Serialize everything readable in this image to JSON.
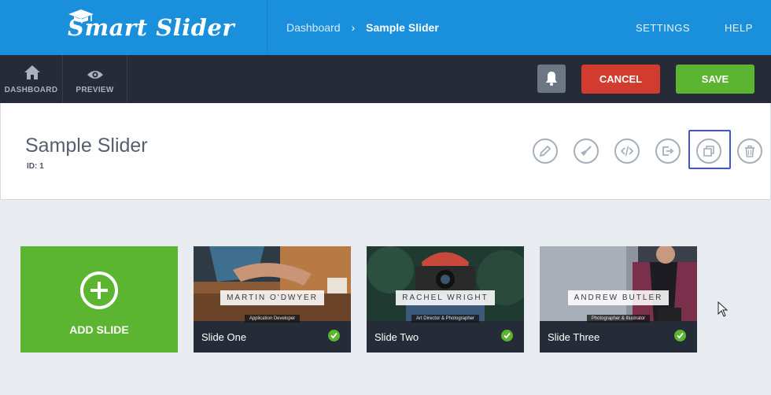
{
  "brand": {
    "name": "Smart Slider"
  },
  "breadcrumb": {
    "root": "Dashboard",
    "separator": "›",
    "current": "Sample Slider"
  },
  "top_links": {
    "settings": "SETTINGS",
    "help": "HELP"
  },
  "toolbar": {
    "dashboard": {
      "label": "DASHBOARD",
      "icon": "home-icon"
    },
    "preview": {
      "label": "PREVIEW",
      "icon": "eye-icon"
    },
    "bell": {
      "icon": "bell-icon"
    },
    "cancel_label": "CANCEL",
    "save_label": "SAVE"
  },
  "slider": {
    "title": "Sample Slider",
    "id_text": "ID: 1"
  },
  "actions": [
    {
      "icon": "pencil-icon",
      "name": "edit"
    },
    {
      "icon": "brush-icon",
      "name": "clear-cache"
    },
    {
      "icon": "code-icon",
      "name": "publish"
    },
    {
      "icon": "export-icon",
      "name": "export"
    },
    {
      "icon": "duplicate-icon",
      "name": "duplicate",
      "highlighted": true
    },
    {
      "icon": "trash-icon",
      "name": "delete"
    }
  ],
  "add_slide": {
    "label": "ADD SLIDE",
    "icon": "plus-circle-icon"
  },
  "slides": [
    {
      "title": "Slide One",
      "caption_name": "MARTIN O'DWYER",
      "caption_role": "Application Developer",
      "published": true
    },
    {
      "title": "Slide Two",
      "caption_name": "RACHEL WRIGHT",
      "caption_role": "Art Director & Photographer",
      "published": true
    },
    {
      "title": "Slide Three",
      "caption_name": "ANDREW BUTLER",
      "caption_role": "Photographer & Illustrator",
      "published": true
    }
  ],
  "colors": {
    "header_blue": "#1a8fdc",
    "toolbar_dark": "#252c38",
    "cancel_red": "#d13c2f",
    "save_green": "#5cb531",
    "highlight_blue": "#4156d6"
  }
}
